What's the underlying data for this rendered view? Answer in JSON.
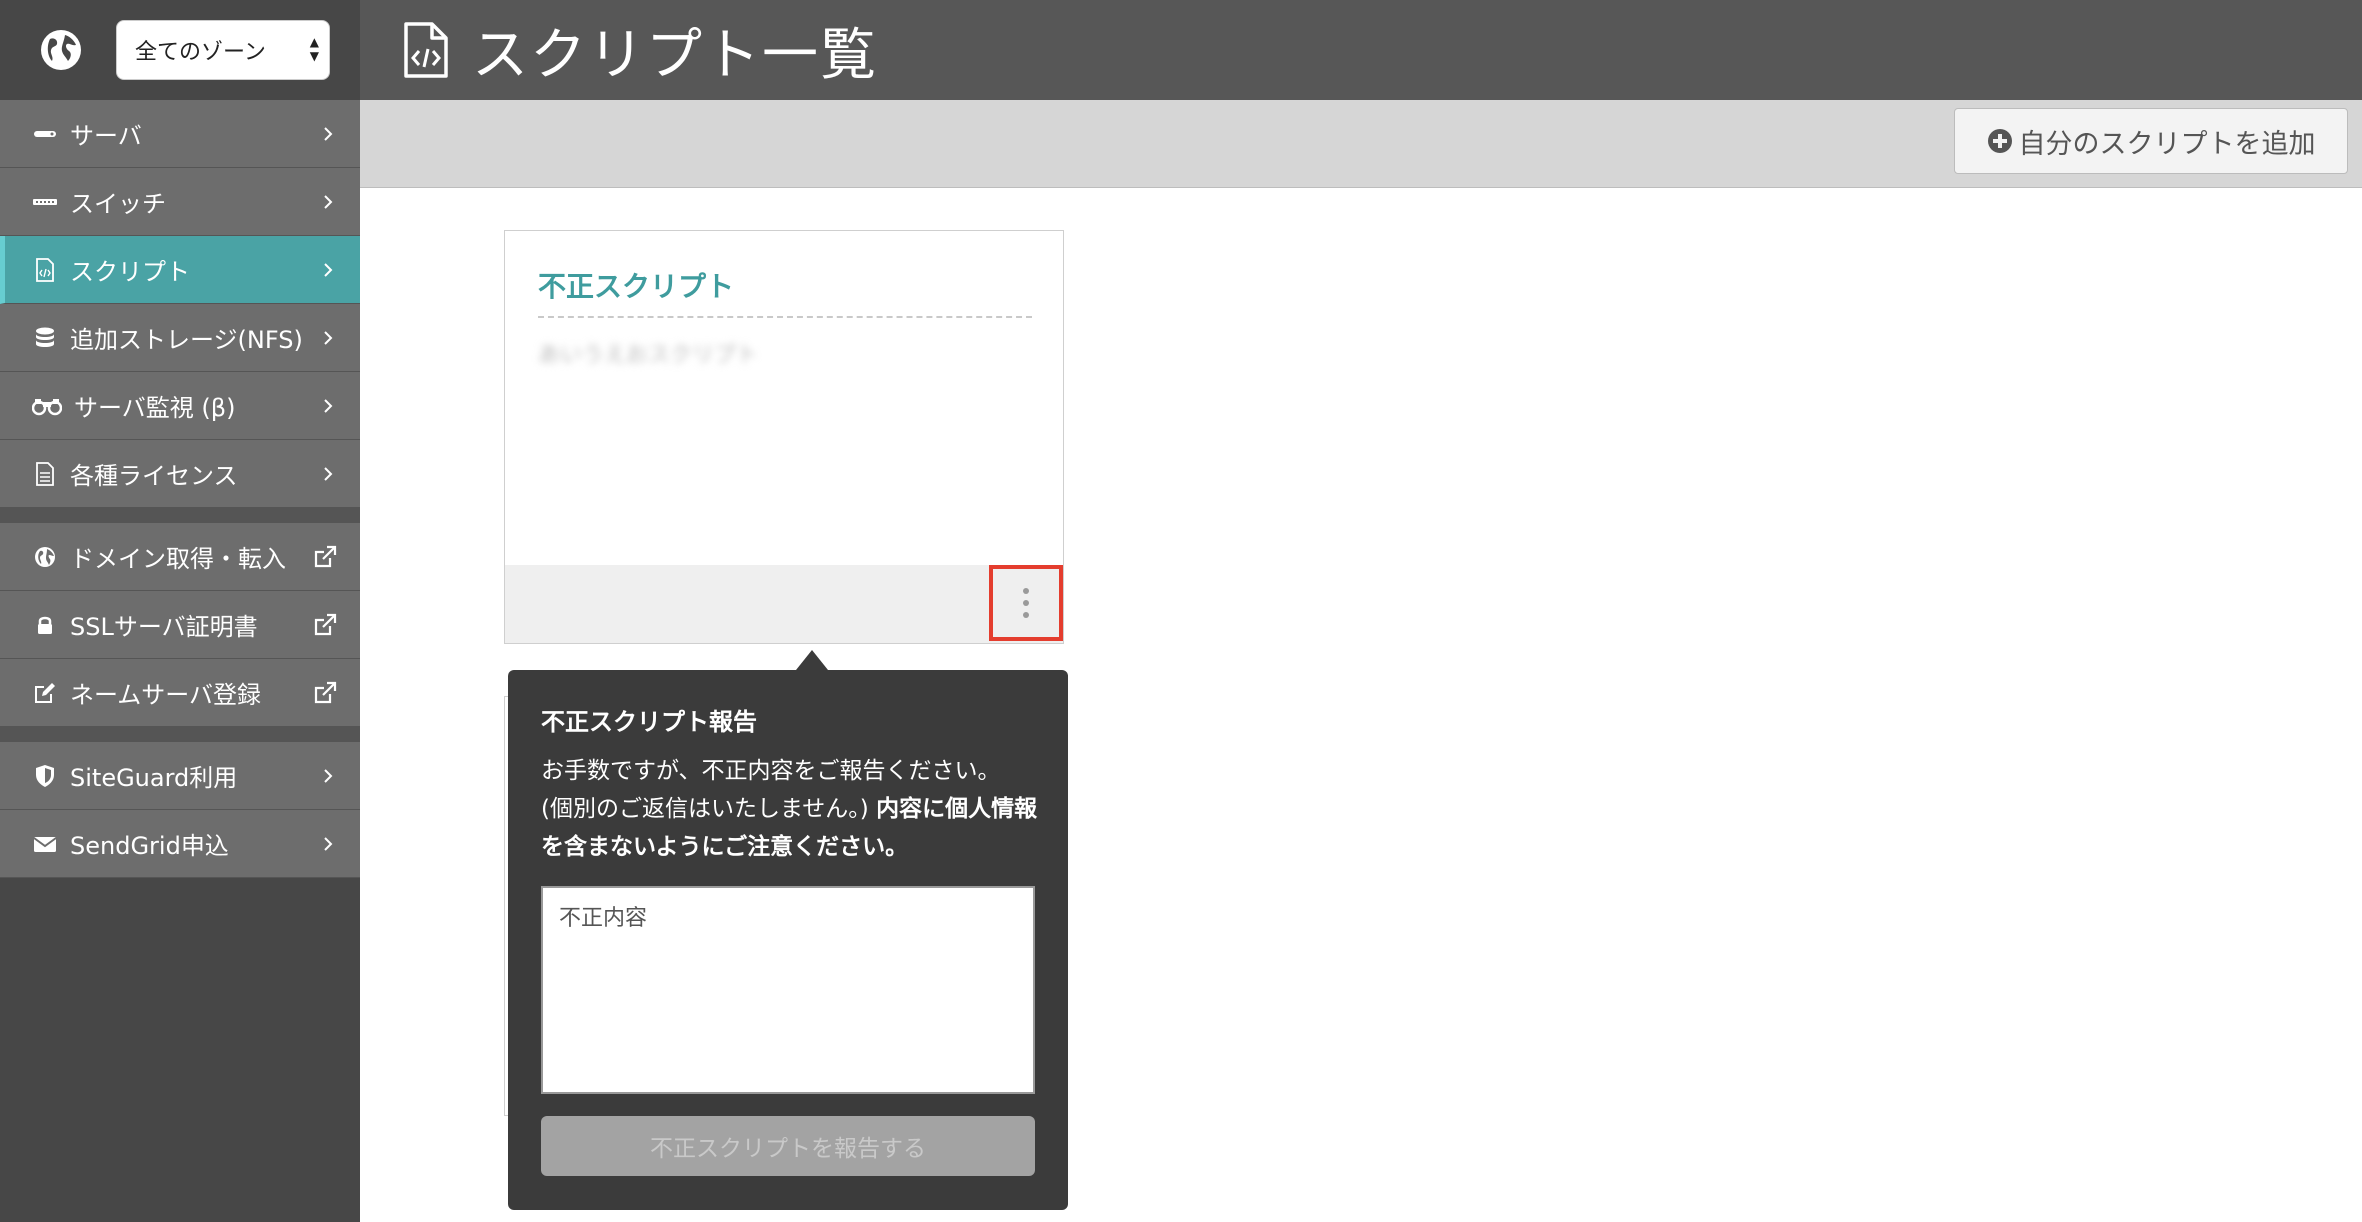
{
  "sidebar": {
    "zone_select": {
      "value": "全てのゾーン"
    },
    "groups": [
      [
        {
          "label": "サーバ",
          "icon": "server-icon",
          "type": "chevron"
        },
        {
          "label": "スイッチ",
          "icon": "switch-icon",
          "type": "chevron"
        },
        {
          "label": "スクリプト",
          "icon": "script-icon",
          "type": "chevron",
          "active": true
        },
        {
          "label": "追加ストレージ(NFS)",
          "icon": "database-icon",
          "type": "chevron"
        },
        {
          "label": "サーバ監視 (β)",
          "icon": "binoculars-icon",
          "type": "chevron"
        },
        {
          "label": "各種ライセンス",
          "icon": "document-icon",
          "type": "chevron"
        }
      ],
      [
        {
          "label": "ドメイン取得・転入",
          "icon": "globe-icon",
          "type": "external"
        },
        {
          "label": "SSLサーバ証明書",
          "icon": "lock-icon",
          "type": "external"
        },
        {
          "label": "ネームサーバ登録",
          "icon": "edit-icon",
          "type": "external"
        }
      ],
      [
        {
          "label": "SiteGuard利用",
          "icon": "shield-icon",
          "type": "chevron"
        },
        {
          "label": "SendGrid申込",
          "icon": "envelope-icon",
          "type": "chevron"
        }
      ]
    ]
  },
  "header": {
    "title": "スクリプト一覧"
  },
  "toolbar": {
    "add_script_label": "自分のスクリプトを追加"
  },
  "card": {
    "title": "不正スクリプト",
    "description": "あいうえおスクリプト"
  },
  "popover": {
    "title": "不正スクリプト報告",
    "body_line1": "お手数ですが、不正内容をご報告ください。",
    "body_line2": "(個別のご返信はいたしません。) ",
    "body_bold": "内容に個人情報を含まないようにご注意ください。",
    "textarea_placeholder": "不正内容",
    "submit_label": "不正スクリプトを報告する"
  },
  "colors": {
    "sidebar_bg": "#474747",
    "nav_item_bg": "#6d6d6d",
    "active_teal": "#4aa3a5",
    "header_bg": "#575757",
    "card_title": "#3f9c9e",
    "highlight_red": "#e43d2e",
    "popover_bg": "#3b3b3b"
  }
}
